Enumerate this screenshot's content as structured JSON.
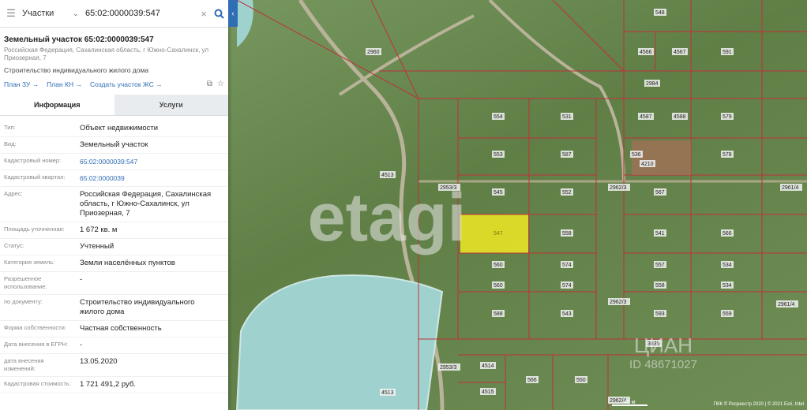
{
  "search": {
    "layer": "Участки",
    "query": "65:02:0000039:547"
  },
  "card": {
    "title": "Земельный участок 65:02:0000039:547",
    "address_line1": "Российская Федерация, Сахалинская область, г Южно-Сахалинск, ул",
    "address_line2": "Приозерная, 7",
    "purpose": "Строительство индивидуального жилого дома",
    "links": [
      "План ЗУ →",
      "План КН →",
      "Создать участок ЖС →"
    ]
  },
  "tabs": [
    {
      "label": "Информация",
      "active": true
    },
    {
      "label": "Услуги",
      "active": false
    }
  ],
  "info": [
    {
      "label": "Тип:",
      "value": [
        "Объект недвижимости"
      ]
    },
    {
      "label": "Вид:",
      "value": [
        "Земельный участок"
      ]
    },
    {
      "label": "Кадастровый номер:",
      "value": [
        "65:02:0000039:547"
      ],
      "link": true
    },
    {
      "label": "Кадастровый квартал:",
      "value": [
        "65:02:0000039"
      ],
      "link": true
    },
    {
      "label": "Адрес:",
      "value": [
        "Российская Федерация, Сахалинская",
        "область, г Южно-Сахалинск, ул",
        "Приозерная, 7"
      ]
    },
    {
      "label": "Площадь уточненная:",
      "value": [
        "1 672 кв. м"
      ]
    },
    {
      "label": "Статус:",
      "value": [
        "Учтенный"
      ]
    },
    {
      "label": "Категория земель:",
      "value": [
        "Земли населённых пунктов"
      ]
    },
    {
      "label": [
        "Разрешенное",
        "использование:"
      ],
      "value": [
        "-"
      ]
    },
    {
      "label": "по документу:",
      "value": [
        "Строительство индивидуального",
        "жилого дома"
      ]
    },
    {
      "label": "Форма собственности:",
      "value": [
        "Частная собственность"
      ]
    },
    {
      "label": "Дата внесения в ЕГРН:",
      "value": [
        "-"
      ]
    },
    {
      "label": [
        "дата внесения",
        "изменений:"
      ],
      "value": [
        "13.05.2020"
      ]
    },
    {
      "label": "Кадастровая стоимость:",
      "value": [
        "1 721 491,2 руб."
      ]
    }
  ],
  "map": {
    "watermark": "etagi",
    "watermark2": "ЦИАН",
    "watermark3": "ID 48671027",
    "scale": "40 м",
    "attribution": "ПКК © Росреестр 2020 | © 2021 Esri, Intel",
    "colors": {
      "boundary": "#c0303a",
      "selected": "#e8e227",
      "water": "#8fcfcf",
      "grass": "#6b8a4a"
    },
    "labels": [
      "548",
      "2960",
      "4566",
      "4567",
      "591",
      "2984",
      "554",
      "531",
      "4587",
      "4588",
      "579",
      "553",
      "587",
      "536",
      "4210",
      "578",
      "2953/3",
      "4513",
      "545",
      "552",
      "2962/3",
      "567",
      "2961/4",
      "547",
      "558",
      "541",
      "566",
      "560",
      "574",
      "557",
      "534",
      "560",
      "574",
      "558",
      "534",
      "2962/3",
      "588",
      "543",
      "593",
      "559",
      "2961/4",
      "3839",
      "2953/3",
      "4514",
      "566",
      "550",
      "4515",
      "4513",
      "2962/4"
    ]
  }
}
